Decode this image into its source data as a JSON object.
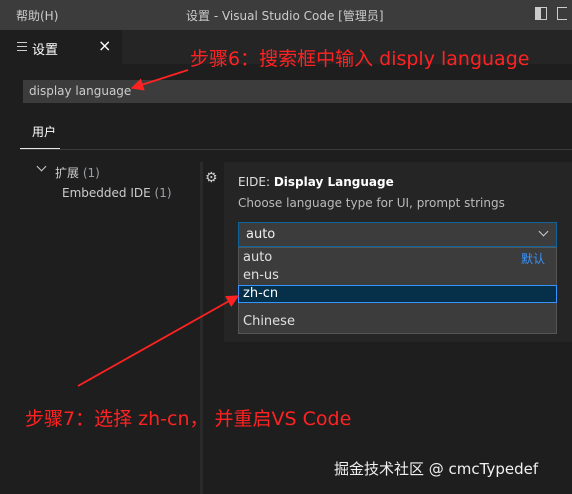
{
  "titlebar": {
    "menu_help": "帮助(H)",
    "window_title": "设置 - Visual Studio Code [管理员]"
  },
  "tab": {
    "label": "设置",
    "close_glyph": "×"
  },
  "search": {
    "value": "display language"
  },
  "scope": {
    "user_tab": "用户"
  },
  "toc": {
    "extensions_label": "扩展",
    "extensions_count": "(1)",
    "eide_label": "Embedded IDE",
    "eide_count": "(1)"
  },
  "setting": {
    "category": "EIDE: ",
    "title": "Display Language",
    "description": "Choose language type for UI, prompt strings",
    "current_value": "auto",
    "options": [
      "auto",
      "en-us",
      "zh-cn"
    ],
    "default_badge": "默认",
    "option_description": "Chinese"
  },
  "annotations": {
    "step6": "步骤6：搜索框中输入 disply language",
    "step7": "步骤7：选择 zh-cn， 并重启VS Code",
    "color": "#ff2222"
  },
  "watermark": "掘金技术社区 @ cmcTypedef",
  "icons": [
    "settings-list-icon",
    "close-icon",
    "chevron-down-icon",
    "gear-icon",
    "layout-icon",
    "restore-icon"
  ]
}
